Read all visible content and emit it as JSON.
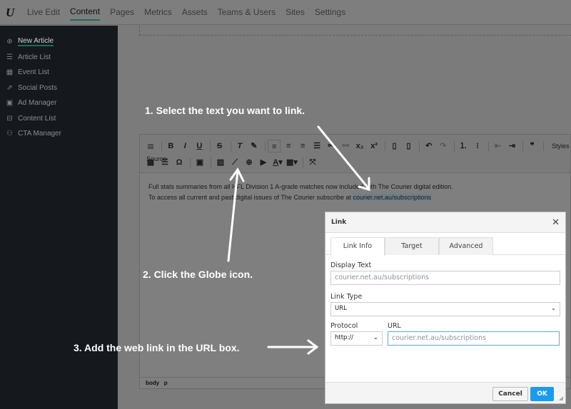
{
  "topnav": {
    "items": [
      "Live Edit",
      "Content",
      "Pages",
      "Metrics",
      "Assets",
      "Teams & Users",
      "Sites",
      "Settings"
    ],
    "active": "Content"
  },
  "sidebar": {
    "items": [
      {
        "label": "New Article",
        "icon": "plus-circle-icon"
      },
      {
        "label": "Article List",
        "icon": "list-icon"
      },
      {
        "label": "Event List",
        "icon": "calendar-icon"
      },
      {
        "label": "Social Posts",
        "icon": "share-icon"
      },
      {
        "label": "Ad Manager",
        "icon": "ad-icon"
      },
      {
        "label": "Content List",
        "icon": "table-icon"
      },
      {
        "label": "CTA Manager",
        "icon": "sitemap-icon"
      }
    ]
  },
  "editor": {
    "source_label": "Source",
    "styles_label": "Styles",
    "line1": "Full stats summaries from all HFL Division 1 A-grade matches now included with The Courier digital edition.",
    "line2_prefix": "To access all current and past digital issues of The Courier subscribe at ",
    "line2_link": "courier.net.au/subscriptions",
    "status": [
      "body",
      "p"
    ]
  },
  "annotations": [
    "1. Select the text you want to link.",
    "2. Click the Globe icon.",
    "3. Add the web link in the URL box."
  ],
  "dialog": {
    "title": "Link",
    "tabs": [
      "Link Info",
      "Target",
      "Advanced"
    ],
    "display_text_label": "Display Text",
    "display_text_value": "courier.net.au/subscriptions",
    "link_type_label": "Link Type",
    "link_type_value": "URL",
    "protocol_label": "Protocol",
    "protocol_value": "http://",
    "url_label": "URL",
    "url_value": "courier.net.au/subscriptions",
    "cancel": "Cancel",
    "ok": "OK"
  },
  "colors": {
    "accent": "#1e6b5e",
    "ok_button": "#1a9bf0",
    "sidebar": "#15191e"
  }
}
